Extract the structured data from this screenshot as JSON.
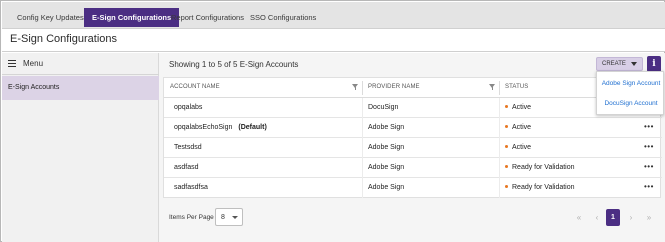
{
  "tabs": [
    {
      "label": "Config Key Updates",
      "active": false
    },
    {
      "label": "E-Sign Configurations",
      "active": true
    },
    {
      "label": "Report Configurations",
      "active": false
    },
    {
      "label": "SSO Configurations",
      "active": false
    }
  ],
  "page": {
    "title": "E-Sign Configurations"
  },
  "sidebar": {
    "menu_label": "Menu",
    "menu_icon": "hamburger-icon",
    "items": [
      {
        "label": "E-Sign Accounts",
        "selected": true
      }
    ]
  },
  "main": {
    "showing_text": "Showing 1 to 5 of 5 E-Sign Accounts",
    "create_label": "CREATE",
    "info_label": "i",
    "columns": {
      "account_name": "ACCOUNT NAME",
      "provider_name": "PROVIDER NAME",
      "status": "STATUS"
    },
    "rows": [
      {
        "account": "opqalabs",
        "tag": "",
        "provider": "DocuSign",
        "status": "Active"
      },
      {
        "account": "opqalabsEchoSign",
        "tag": "(Default)",
        "provider": "Adobe Sign",
        "status": "Active"
      },
      {
        "account": "Testsdsd",
        "tag": "",
        "provider": "Adobe Sign",
        "status": "Active"
      },
      {
        "account": "asdfasd",
        "tag": "",
        "provider": "Adobe Sign",
        "status": "Ready for Validation"
      },
      {
        "account": "sadfasdfsa",
        "tag": "",
        "provider": "Adobe Sign",
        "status": "Ready for Validation"
      }
    ],
    "more_label": "•••",
    "dropdown": [
      "Adobe Sign Account",
      "DocuSign Account"
    ],
    "footer": {
      "items_per_page_label": "Items Per Page",
      "items_per_page_value": "8",
      "pager": {
        "first": "«",
        "prev": "‹",
        "current": "1",
        "next": "›",
        "last": "»"
      }
    }
  },
  "colors": {
    "brand": "#4b2e83",
    "sidebar_selected": "#dcd3e6",
    "create_button": "#d8cfe6",
    "status_dot": "#e87722",
    "link": "#1f6fd0"
  }
}
